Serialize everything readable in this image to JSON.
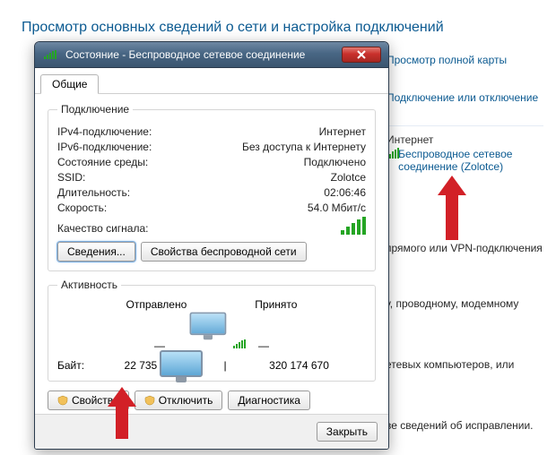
{
  "page": {
    "header": "Просмотр основных сведений о сети и настройка подключений",
    "full_map_link": "Просмотр полной карты",
    "conn_toggle_link": "Подключение или отключение",
    "active": {
      "name": "Интернет",
      "link": "Беспроводное сетевое соединение (Zolotce)"
    },
    "frag1": "прямого или VPN-подключения",
    "frag2": "у, проводному, модемному",
    "frag3": "етевых компьютеров, или",
    "frag4": "ве сведений об исправлении."
  },
  "dialog": {
    "title": "Состояние - Беспроводное сетевое соединение",
    "tab_general": "Общие",
    "groups": {
      "connection": "Подключение",
      "activity": "Активность"
    },
    "rows": {
      "ipv4_label": "IPv4-подключение:",
      "ipv4_value": "Интернет",
      "ipv6_label": "IPv6-подключение:",
      "ipv6_value": "Без доступа к Интернету",
      "media_label": "Состояние среды:",
      "media_value": "Подключено",
      "ssid_label": "SSID:",
      "ssid_value": "Zolotce",
      "duration_label": "Длительность:",
      "duration_value": "02:06:46",
      "speed_label": "Скорость:",
      "speed_value": "54.0 Мбит/с",
      "signal_label": "Качество сигнала:"
    },
    "buttons": {
      "details": "Сведения...",
      "wireless_props": "Свойства беспроводной сети",
      "properties": "Свойства",
      "disable": "Отключить",
      "diagnose": "Диагностика",
      "close": "Закрыть"
    },
    "activity": {
      "sent_label": "Отправлено",
      "recv_label": "Принято",
      "bytes_label": "Байт:",
      "sent_bytes": "22 735 789",
      "recv_bytes": "320 174 670"
    }
  }
}
